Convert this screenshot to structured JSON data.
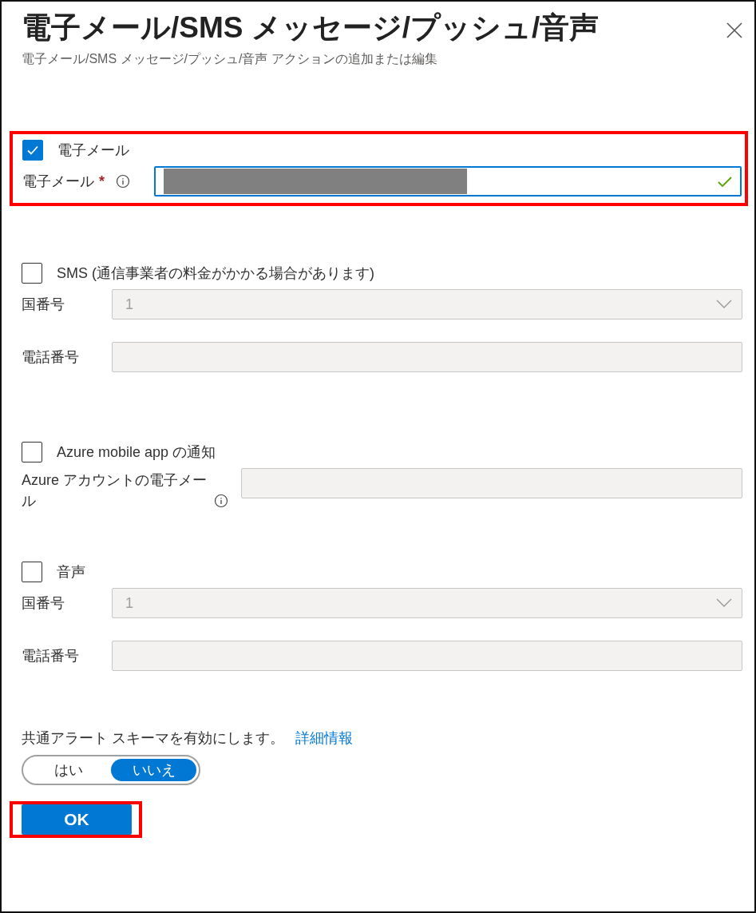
{
  "panel": {
    "title": "電子メール/SMS メッセージ/プッシュ/音声",
    "subtitle": "電子メール/SMS メッセージ/プッシュ/音声 アクションの追加または編集"
  },
  "sections": [
    {
      "highlighted": true,
      "checkbox": {
        "label": "電子メール",
        "checked": true
      },
      "fields": [
        {
          "kind": "text",
          "label": "電子メール",
          "required_mark": "*",
          "info": true,
          "redacted": true,
          "valid": true,
          "focused": true,
          "disabled": false
        }
      ]
    },
    {
      "checkbox": {
        "label": "SMS (通信事業者の料金がかかる場合があります)",
        "checked": false
      },
      "fields": [
        {
          "kind": "select",
          "label": "国番号",
          "value": "1",
          "disabled": true
        },
        {
          "kind": "text",
          "label": "電話番号",
          "disabled": true
        }
      ]
    },
    {
      "checkbox": {
        "label": "Azure mobile app の通知",
        "checked": false
      },
      "fields": [
        {
          "kind": "text",
          "label": "Azure アカウントの電子メール",
          "info": true,
          "disabled": true
        }
      ]
    },
    {
      "checkbox": {
        "label": "音声",
        "checked": false
      },
      "fields": [
        {
          "kind": "select",
          "label": "国番号",
          "value": "1",
          "disabled": true
        },
        {
          "kind": "text",
          "label": "電話番号",
          "disabled": true
        }
      ]
    }
  ],
  "schema": {
    "text": "共通アラート スキーマを有効にします。",
    "link": "詳細情報",
    "options": [
      {
        "label": "はい",
        "selected": false
      },
      {
        "label": "いいえ",
        "selected": true
      }
    ]
  },
  "ok_button": {
    "label": "OK",
    "highlighted": true
  }
}
